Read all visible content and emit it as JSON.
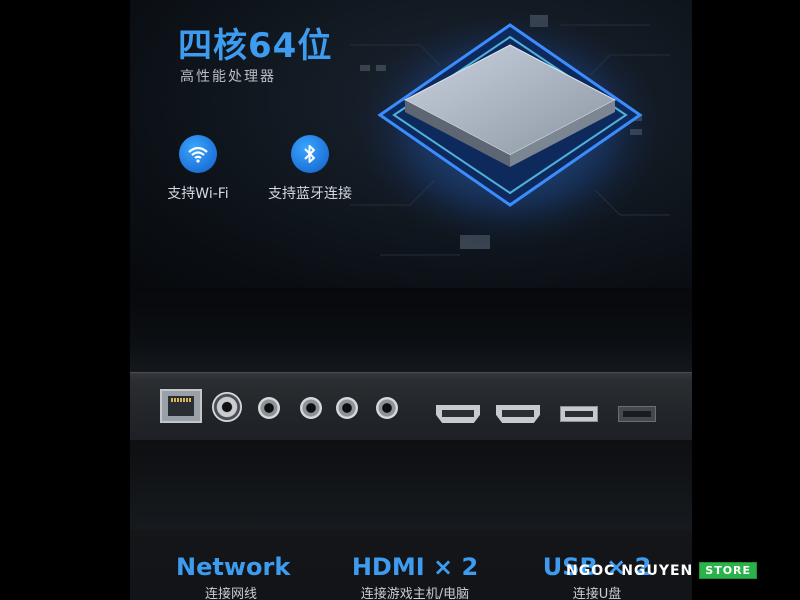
{
  "top": {
    "title": "四核64位",
    "subtitle": "高性能处理器",
    "features": [
      {
        "icon": "wifi-icon",
        "label": "支持Wi-Fi"
      },
      {
        "icon": "bluetooth-icon",
        "label": "支持蓝牙连接"
      }
    ],
    "accent": "#3e9cf0",
    "chip_glow": "#2f7dff"
  },
  "ports": {
    "items": [
      "rj45-port",
      "coax-port",
      "audio-jack-port",
      "audio-jack-port",
      "audio-jack-port",
      "audio-jack-port",
      "hdmi-port",
      "hdmi-port",
      "usb-port",
      "usb-port"
    ],
    "captions": [
      {
        "title": "Network",
        "sub": "连接网线"
      },
      {
        "title": "HDMI × 2",
        "sub": "连接游戏主机/电脑"
      },
      {
        "title": "USB × 2",
        "sub": "连接U盘"
      }
    ]
  },
  "watermark": {
    "text": "NGOC NGUYEN",
    "badge": "STORE",
    "badge_color": "#2bb34a"
  }
}
